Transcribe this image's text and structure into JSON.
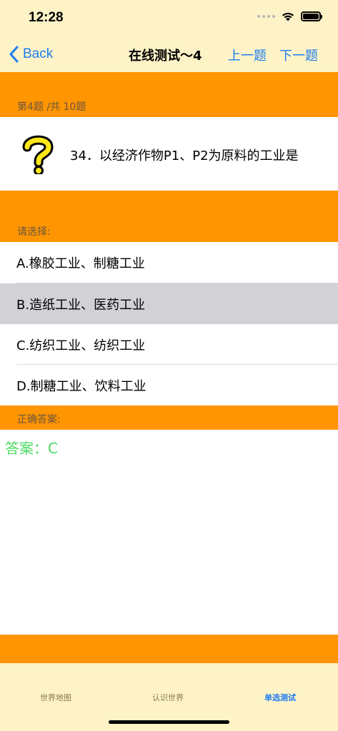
{
  "status": {
    "time": "12:28"
  },
  "nav": {
    "back_label": "Back",
    "title": "在线测试～4",
    "prev_label": "上一题",
    "next_label": "下一题"
  },
  "question": {
    "progress": "第4题 /共 10题",
    "text": "34．以经济作物P1、P2为原料的工业是",
    "icon": "question-mark-icon"
  },
  "choices": {
    "label": "请选择:",
    "options": [
      {
        "label": "A.橡胶工业、制糖工业",
        "selected": false
      },
      {
        "label": "B.造纸工业、医药工业",
        "selected": true
      },
      {
        "label": "C.纺织工业、纺织工业",
        "selected": false
      },
      {
        "label": "D.制糖工业、饮料工业",
        "selected": false
      }
    ]
  },
  "answer": {
    "label": "正确答案:",
    "text": "答案：C"
  },
  "tabs": [
    {
      "label": "世界地图",
      "active": false
    },
    {
      "label": "认识世界",
      "active": false
    },
    {
      "label": "单选测试",
      "active": true
    }
  ],
  "colors": {
    "accent": "#1e7cf2",
    "orange": "#ff9500",
    "cream": "#fdf3c7",
    "answer_green": "#4cd964",
    "selected_gray": "#d1d1d6"
  }
}
